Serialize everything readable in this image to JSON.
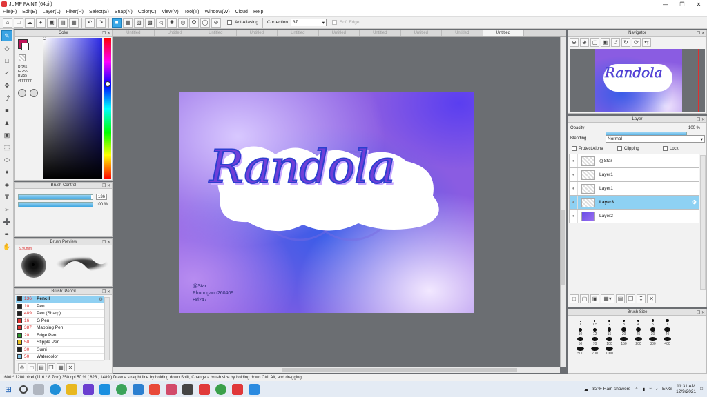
{
  "window": {
    "title": "JUMP PAINT (64bit)"
  },
  "menu": [
    "File(F)",
    "Edit(E)",
    "Layer(L)",
    "Filter(R)",
    "Select(S)",
    "Snap(N)",
    "Color(C)",
    "View(V)",
    "Tool(T)",
    "Window(W)",
    "Cloud",
    "Help"
  ],
  "toolbar": {
    "antialiasing_label": "AntiAliasing",
    "correction_label": "Correction",
    "correction_value": "37",
    "soft_edge_label": "Soft Edge"
  },
  "color_panel": {
    "title": "Color",
    "r": "R:255",
    "g": "G:255",
    "b": "B:255",
    "hex": "#FFFFFF"
  },
  "brush_control": {
    "title": "Brush Control",
    "size_value": "136",
    "opacity_value": "100 %",
    "size_fraction": 0.98,
    "opacity_fraction": 1.0
  },
  "brush_preview": {
    "title": "Brush Preview",
    "size_text": "9.90mm"
  },
  "brush_list": {
    "title": "Brush: Pencil",
    "items": [
      {
        "size": "136",
        "name": "Pencil",
        "color": "#222222",
        "selected": true
      },
      {
        "size": "10",
        "name": "Pen",
        "color": "#222222"
      },
      {
        "size": "489",
        "name": "Pen (Sharp)",
        "color": "#222222"
      },
      {
        "size": "16",
        "name": "G Pen",
        "color": "#e03030"
      },
      {
        "size": "387",
        "name": "Mapping Pen",
        "color": "#e03030"
      },
      {
        "size": "20",
        "name": "Edge Pen",
        "color": "#2a9a2a"
      },
      {
        "size": "50",
        "name": "Stipple Pen",
        "color": "#e8c020"
      },
      {
        "size": "30",
        "name": "Sumi",
        "color": "#222222"
      },
      {
        "size": "50",
        "name": "Watercolor",
        "color": "#7fc4e8"
      }
    ]
  },
  "doc_tabs": [
    "Untitled",
    "Untitled",
    "Untitled",
    "Untitled",
    "Untitled",
    "Untitled",
    "Untitled",
    "Untitled",
    "Untitled",
    "Untitled"
  ],
  "artwork": {
    "title": "Randola",
    "credits": [
      "@Star",
      "Phuonganh260409",
      "Hd247"
    ]
  },
  "navigator": {
    "title": "Navigator"
  },
  "layer_panel": {
    "title": "Layer",
    "opacity_label": "Opacity",
    "opacity_value": "100 %",
    "opacity_fraction": 1.0,
    "blending_label": "Blending",
    "blending_value": "Normal",
    "protect_alpha_label": "Protect Alpha",
    "clipping_label": "Clipping",
    "lock_label": "Lock",
    "layers": [
      {
        "name": "@Star"
      },
      {
        "name": "Layer1"
      },
      {
        "name": "Layer1"
      },
      {
        "name": "Layer3",
        "selected": true
      },
      {
        "name": "Layer2"
      }
    ]
  },
  "brush_size": {
    "title": "Brush Size",
    "sizes": [
      "1",
      "1.5",
      "2",
      "3",
      "4",
      "5",
      "7",
      "10",
      "12",
      "15",
      "20",
      "25",
      "30",
      "40",
      "50",
      "70",
      "100",
      "150",
      "200",
      "300",
      "400",
      "500",
      "700",
      "1000"
    ]
  },
  "statusbar": {
    "text": "1600 * 1200 pixel   (11.6 * 8.7cm)   350 dpi   50 %   ( 823 , 1489 )   Draw a straight line by holding down Shift, Change a brush size by holding down Ctrl, Alt, and dragging"
  },
  "taskbar": {
    "weather": "83°F  Rain showers",
    "lang": "ENG",
    "time": "11:31 AM",
    "date": "12/9/2021"
  },
  "colors": {
    "accent": "#39a7e6",
    "primary_color": "#c0155a"
  }
}
